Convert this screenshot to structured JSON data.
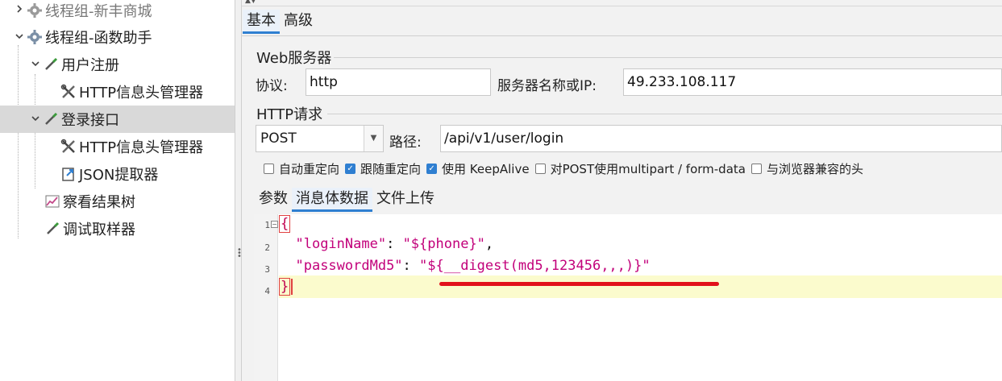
{
  "tree": {
    "items": [
      {
        "label": "线程组-新丰商城",
        "arrow": "›",
        "icon": "gear-icon"
      },
      {
        "label": "线程组-函数助手",
        "arrow": "⌄",
        "icon": "gear-icon"
      },
      {
        "label": "用户注册",
        "arrow": "⌄",
        "icon": "pipette-icon"
      },
      {
        "label": "HTTP信息头管理器",
        "icon": "wrench-icon"
      },
      {
        "label": "登录接口",
        "arrow": "⌄",
        "icon": "pipette-icon",
        "selected": true
      },
      {
        "label": "HTTP信息头管理器",
        "icon": "wrench-icon"
      },
      {
        "label": "JSON提取器",
        "icon": "extractor-icon"
      },
      {
        "label": "察看结果树",
        "icon": "chart-icon"
      },
      {
        "label": "调试取样器",
        "icon": "pipette-icon"
      }
    ]
  },
  "tabs": {
    "basic": "基本",
    "advanced": "高级"
  },
  "web_server": {
    "title": "Web服务器",
    "protocol_label": "协议:",
    "protocol_value": "http",
    "server_label": "服务器名称或IP:",
    "server_value": "49.233.108.117"
  },
  "http_request": {
    "title": "HTTP请求",
    "method": "POST",
    "path_label": "路径:",
    "path_value": "/api/v1/user/login"
  },
  "options": [
    {
      "label": "自动重定向",
      "checked": false
    },
    {
      "label": "跟随重定向",
      "checked": true
    },
    {
      "label": "使用 KeepAlive",
      "checked": true
    },
    {
      "label": "对POST使用multipart / form-data",
      "checked": false
    },
    {
      "label": "与浏览器兼容的头",
      "checked": false
    }
  ],
  "sub_tabs": {
    "params": "参数",
    "body": "消息体数据",
    "files": "文件上传"
  },
  "editor": {
    "line_numbers": [
      "1",
      "2",
      "3",
      "4"
    ],
    "open_brace": "{",
    "close_brace": "}",
    "line2_key": "\"loginName\"",
    "line2_sep": ": ",
    "line2_val": "\"${phone}\"",
    "line2_tail": ",",
    "line3_key": "\"passwordMd5\"",
    "line3_sep": ": ",
    "line3_val": "\"${__digest(md5,123456,,,)}\""
  },
  "colors": {
    "accent": "#2f7fd1",
    "string": "#c2007a",
    "underline": "#e2111b",
    "current_line": "#fbfbcd"
  }
}
